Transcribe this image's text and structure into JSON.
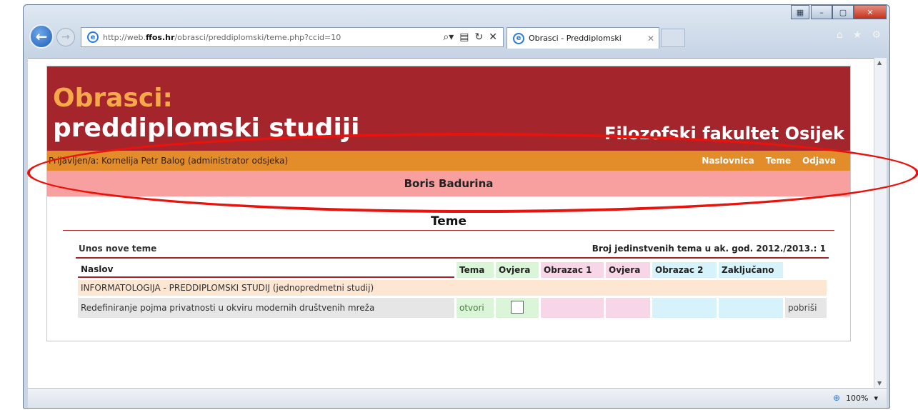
{
  "browser": {
    "url_prefix": "http://web.",
    "url_host": "ffos.hr",
    "url_path": "/obrasci/preddiplomski/teme.php?ccid=10",
    "tab_title": "Obrasci - Preddiplomski",
    "zoom": "100%",
    "icons": {
      "back": "back-arrow-icon",
      "forward": "forward-arrow-icon",
      "home": "home-icon",
      "favorites": "star-icon",
      "tools": "gear-icon"
    }
  },
  "banner": {
    "title1": "Obrasci:",
    "title2": "preddiplomski studiji",
    "faculty": "Filozofski fakultet Osijek"
  },
  "login": {
    "text": "Prijavljen/a: Kornelija Petr Balog (administrator odsjeka)",
    "links": [
      "Naslovnica",
      "Teme",
      "Odjava"
    ]
  },
  "student_name": "Boris Badurina",
  "section_title": "Teme",
  "table": {
    "new_topic": "Unos nove teme",
    "count_text": "Broj jedinstvenih tema u ak. god. 2012./2013.: 1",
    "headers": {
      "naslov": "Naslov",
      "tema": "Tema",
      "ovjera1": "Ovjera",
      "obrazac1": "Obrazac 1",
      "ovjera2": "Ovjera",
      "obrazac2": "Obrazac 2",
      "zakljucano": "Zaključano"
    },
    "program": "INFORMATOLOGIJA - PREDDIPLOMSKI STUDIJ (jednopredmetni studij)",
    "rows": [
      {
        "title": "Redefiniranje pojma privatnosti u okviru modernih društvenih mreža",
        "tema": "otvori",
        "delete": "pobriši"
      }
    ]
  },
  "colors": {
    "banner": "#a4262c",
    "login_bar": "#e38d2a",
    "name_bar": "#f8a0a0",
    "annotation": "#e8130c"
  }
}
